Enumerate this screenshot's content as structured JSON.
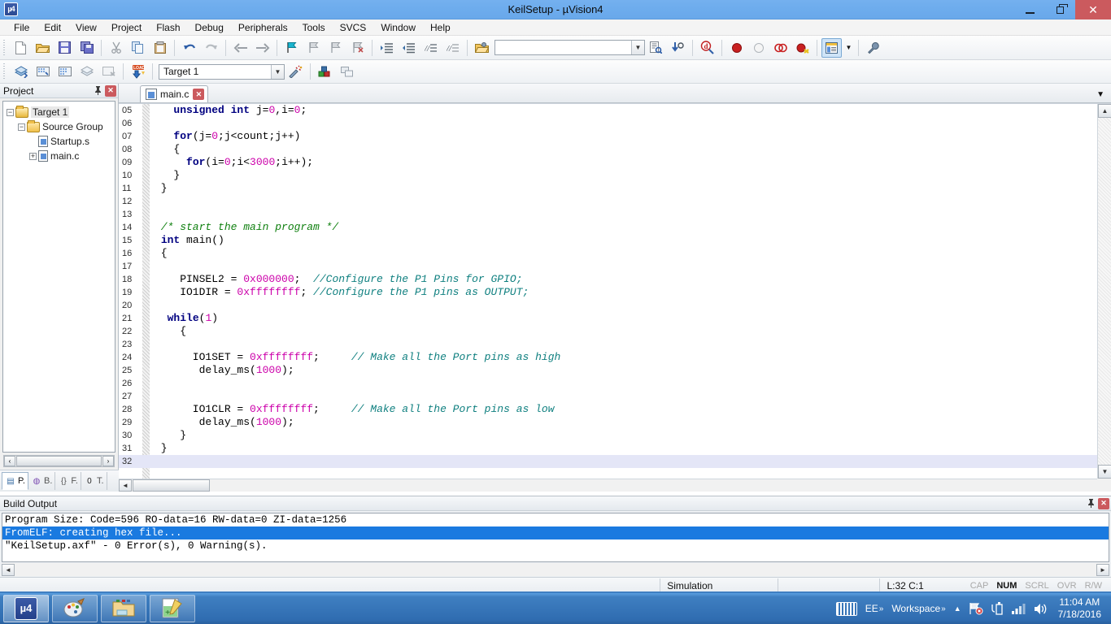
{
  "window": {
    "title": "KeilSetup  - µVision4",
    "app_icon": "uvision-logo-icon",
    "minimize": "–",
    "restore": "❐",
    "close": "✕"
  },
  "menubar": {
    "items": [
      "File",
      "Edit",
      "View",
      "Project",
      "Flash",
      "Debug",
      "Peripherals",
      "Tools",
      "SVCS",
      "Window",
      "Help"
    ]
  },
  "toolbar_main": {
    "buttons": [
      {
        "name": "new-file-button",
        "glyph": "📄"
      },
      {
        "name": "open-file-button",
        "glyph": "📂"
      },
      {
        "name": "save-button",
        "glyph": "💾"
      },
      {
        "name": "save-all-button",
        "glyph": "🗐"
      },
      {
        "name": "cut-button",
        "glyph": "✂"
      },
      {
        "name": "copy-button",
        "glyph": "⧉"
      },
      {
        "name": "paste-button",
        "glyph": "📋"
      },
      {
        "name": "undo-button",
        "glyph": "↶"
      },
      {
        "name": "redo-button",
        "glyph": "↷"
      },
      {
        "name": "navigate-back-button",
        "glyph": "←"
      },
      {
        "name": "navigate-forward-button",
        "glyph": "→"
      },
      {
        "name": "bookmark-toggle-button",
        "glyph": "⚑"
      },
      {
        "name": "bookmark-prev-button",
        "glyph": "⚐"
      },
      {
        "name": "bookmark-next-button",
        "glyph": "⚐"
      },
      {
        "name": "bookmark-clear-button",
        "glyph": "⚐"
      },
      {
        "name": "indent-button",
        "glyph": "⇥"
      },
      {
        "name": "outdent-button",
        "glyph": "⇤"
      },
      {
        "name": "comment-button",
        "glyph": "//"
      },
      {
        "name": "uncomment-button",
        "glyph": "//"
      },
      {
        "name": "open-folder-button",
        "glyph": "📁"
      }
    ],
    "search_value": "",
    "search_placeholder": "",
    "find-in-files-button": "🔎",
    "goto-button": "⇩",
    "zoom-button": "🔍",
    "debug_buttons": [
      {
        "name": "insert-breakpoint-button",
        "glyph": "●"
      },
      {
        "name": "remove-breakpoint-button",
        "glyph": "○"
      },
      {
        "name": "disable-breakpoint-button",
        "glyph": "⊘"
      },
      {
        "name": "kill-all-breakpoints-button",
        "glyph": "⊗"
      }
    ],
    "window-layout-button": "▤",
    "configuration-button": "🔧"
  },
  "toolbar_build": {
    "buttons": [
      {
        "name": "translate-button",
        "glyph": "◈"
      },
      {
        "name": "build-target-button",
        "glyph": "▦"
      },
      {
        "name": "rebuild-all-button",
        "glyph": "▩"
      },
      {
        "name": "batch-build-button",
        "glyph": "▤"
      },
      {
        "name": "stop-build-button",
        "glyph": "▨"
      },
      {
        "name": "download-to-flash-button",
        "glyph": "LOAD"
      }
    ],
    "target_value": "Target 1",
    "target_options": [
      "Target 1"
    ],
    "options-for-target-button": "🪄",
    "manage-components-button": "🧱",
    "manage-multi-project-button": "🗗"
  },
  "project_panel": {
    "title": "Project",
    "pin_button": "📌",
    "close_button": "✕",
    "tree": [
      {
        "label": "Target 1",
        "type": "target",
        "expander": "−",
        "depth": 0,
        "selected": true
      },
      {
        "label": "Source Group",
        "type": "folder",
        "expander": "−",
        "depth": 1,
        "selected": false
      },
      {
        "label": "Startup.s",
        "type": "file",
        "expander": "",
        "depth": 2,
        "selected": false
      },
      {
        "label": "main.c",
        "type": "file",
        "expander": "+",
        "depth": 2,
        "selected": false
      }
    ],
    "tabs": [
      {
        "label": "P.",
        "icon": "project-icon",
        "selected": true
      },
      {
        "label": "B.",
        "icon": "books-icon",
        "selected": false
      },
      {
        "label": "F.",
        "icon": "functions-icon",
        "selected": false
      },
      {
        "label": "T.",
        "icon": "templates-icon",
        "selected": false
      }
    ],
    "scroll_left": "‹",
    "scroll_right": "›"
  },
  "editor": {
    "tab_label": "main.c",
    "tab_close": "✕",
    "tab_dropdown": "▼",
    "current_line": 32,
    "lines": [
      {
        "n": "05",
        "segs": [
          {
            "t": "   ",
            "c": ""
          },
          {
            "t": "unsigned int",
            "c": "kw"
          },
          {
            "t": " j=",
            "c": ""
          },
          {
            "t": "0",
            "c": "num-lit"
          },
          {
            "t": ",i=",
            "c": ""
          },
          {
            "t": "0",
            "c": "num-lit"
          },
          {
            "t": ";",
            "c": ""
          }
        ]
      },
      {
        "n": "06",
        "segs": []
      },
      {
        "n": "07",
        "segs": [
          {
            "t": "   ",
            "c": ""
          },
          {
            "t": "for",
            "c": "kw"
          },
          {
            "t": "(j=",
            "c": ""
          },
          {
            "t": "0",
            "c": "num-lit"
          },
          {
            "t": ";j<count;j++)",
            "c": ""
          }
        ]
      },
      {
        "n": "08",
        "segs": [
          {
            "t": "   {",
            "c": ""
          }
        ]
      },
      {
        "n": "09",
        "segs": [
          {
            "t": "     ",
            "c": ""
          },
          {
            "t": "for",
            "c": "kw"
          },
          {
            "t": "(i=",
            "c": ""
          },
          {
            "t": "0",
            "c": "num-lit"
          },
          {
            "t": ";i<",
            "c": ""
          },
          {
            "t": "3000",
            "c": "num-lit"
          },
          {
            "t": ";i++);",
            "c": ""
          }
        ]
      },
      {
        "n": "10",
        "segs": [
          {
            "t": "   }",
            "c": ""
          }
        ]
      },
      {
        "n": "11",
        "segs": [
          {
            "t": " }",
            "c": ""
          }
        ]
      },
      {
        "n": "12",
        "segs": []
      },
      {
        "n": "13",
        "segs": []
      },
      {
        "n": "14",
        "segs": [
          {
            "t": " /* start the main program */",
            "c": "cmt-green"
          }
        ]
      },
      {
        "n": "15",
        "segs": [
          {
            "t": " ",
            "c": ""
          },
          {
            "t": "int",
            "c": "kw"
          },
          {
            "t": " main()",
            "c": ""
          }
        ]
      },
      {
        "n": "16",
        "segs": [
          {
            "t": " {",
            "c": ""
          }
        ]
      },
      {
        "n": "17",
        "segs": []
      },
      {
        "n": "18",
        "segs": [
          {
            "t": "    PINSEL2 = ",
            "c": ""
          },
          {
            "t": "0x000000",
            "c": "num-lit"
          },
          {
            "t": ";  ",
            "c": ""
          },
          {
            "t": "//Configure the P1 Pins for GPIO;",
            "c": "cmt-teal"
          }
        ]
      },
      {
        "n": "19",
        "segs": [
          {
            "t": "    IO1DIR = ",
            "c": ""
          },
          {
            "t": "0xffffffff",
            "c": "num-lit"
          },
          {
            "t": "; ",
            "c": ""
          },
          {
            "t": "//Configure the P1 pins as OUTPUT;",
            "c": "cmt-teal"
          }
        ]
      },
      {
        "n": "20",
        "segs": []
      },
      {
        "n": "21",
        "segs": [
          {
            "t": "  ",
            "c": ""
          },
          {
            "t": "while",
            "c": "kw"
          },
          {
            "t": "(",
            "c": ""
          },
          {
            "t": "1",
            "c": "num-lit"
          },
          {
            "t": ")",
            "c": ""
          }
        ]
      },
      {
        "n": "22",
        "segs": [
          {
            "t": "    {",
            "c": ""
          }
        ]
      },
      {
        "n": "23",
        "segs": []
      },
      {
        "n": "24",
        "segs": [
          {
            "t": "      IO1SET = ",
            "c": ""
          },
          {
            "t": "0xffffffff",
            "c": "num-lit"
          },
          {
            "t": ";     ",
            "c": ""
          },
          {
            "t": "// Make all the Port pins as high",
            "c": "cmt-teal"
          }
        ]
      },
      {
        "n": "25",
        "segs": [
          {
            "t": "       delay_ms(",
            "c": ""
          },
          {
            "t": "1000",
            "c": "num-lit"
          },
          {
            "t": ");",
            "c": ""
          }
        ]
      },
      {
        "n": "26",
        "segs": []
      },
      {
        "n": "27",
        "segs": []
      },
      {
        "n": "28",
        "segs": [
          {
            "t": "      IO1CLR = ",
            "c": ""
          },
          {
            "t": "0xffffffff",
            "c": "num-lit"
          },
          {
            "t": ";     ",
            "c": ""
          },
          {
            "t": "// Make all the Port pins as low",
            "c": "cmt-teal"
          }
        ]
      },
      {
        "n": "29",
        "segs": [
          {
            "t": "       delay_ms(",
            "c": ""
          },
          {
            "t": "1000",
            "c": "num-lit"
          },
          {
            "t": ");",
            "c": ""
          }
        ]
      },
      {
        "n": "30",
        "segs": [
          {
            "t": "    }",
            "c": ""
          }
        ]
      },
      {
        "n": "31",
        "segs": [
          {
            "t": " }",
            "c": ""
          }
        ]
      },
      {
        "n": "32",
        "segs": []
      }
    ]
  },
  "build_output": {
    "title": "Build Output",
    "pin_button": "📌",
    "close_button": "✕",
    "lines": [
      {
        "text": "Program Size: Code=596 RO-data=16 RW-data=0 ZI-data=1256",
        "selected": false
      },
      {
        "text": "FromELF: creating hex file...",
        "selected": true
      },
      {
        "text": "\"KeilSetup.axf\" - 0 Error(s), 0 Warning(s).",
        "selected": false
      }
    ]
  },
  "statusbar": {
    "simulation": "Simulation",
    "blank": "",
    "cursor": "L:32 C:1",
    "flags": [
      {
        "label": "CAP",
        "on": false
      },
      {
        "label": "NUM",
        "on": true
      },
      {
        "label": "SCRL",
        "on": false
      },
      {
        "label": "OVR",
        "on": false
      },
      {
        "label": "R/W",
        "on": false
      }
    ]
  },
  "taskbar": {
    "apps": [
      {
        "name": "taskbar-uvision",
        "glyph": "µ4",
        "active": true
      },
      {
        "name": "taskbar-paint",
        "glyph": "🎨",
        "active": false
      },
      {
        "name": "taskbar-explorer",
        "glyph": "📁",
        "active": false
      },
      {
        "name": "taskbar-notepadpp",
        "glyph": "📝",
        "active": false
      }
    ],
    "tray": {
      "keyboard_icon": "keyboard-icon",
      "lang": "EE",
      "lang_chevron": "»",
      "workspace": "Workspace",
      "workspace_chevron": "»",
      "show_hidden": "▲",
      "network_icon": "network-error-icon",
      "usb_icon": "usb-device-icon",
      "signal_icon": "signal-bars-icon",
      "volume_icon": "volume-icon",
      "time": "11:04 AM",
      "date": "7/18/2016"
    }
  },
  "colors": {
    "accent": "#3f7fc1",
    "title_bar": "#6daced",
    "close_red": "#cb5a5e",
    "selection_blue": "#1a7ae0",
    "keyword": "#000080",
    "number_literal": "#cc00aa",
    "comment_block": "#108010",
    "comment_line": "#108080",
    "current_line": "#e4e6f7"
  }
}
